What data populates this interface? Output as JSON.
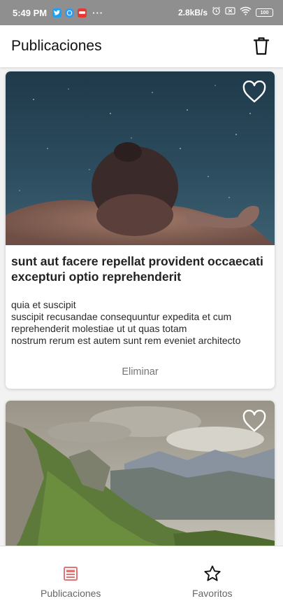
{
  "status_bar": {
    "time": "5:49 PM",
    "app_icons": [
      "twitter-icon",
      "whatsapp-icon",
      "app-notification-icon"
    ],
    "more": "···",
    "network_speed": "2.8kB/s",
    "battery": "100"
  },
  "app_bar": {
    "title": "Publicaciones",
    "action_icon": "trash-icon"
  },
  "posts": [
    {
      "image": "underwater-swimmer-photo",
      "title": "sunt aut facere repellat provident occaecati excepturi optio reprehenderit",
      "body": "quia et suscipit\nsuscipit recusandae consequuntur expedita et cum reprehenderit molestiae ut ut quas totam\nnostrum rerum est autem sunt rem eveniet architecto",
      "action_label": "Eliminar",
      "favorite_icon": "heart-outline-icon"
    },
    {
      "image": "mountain-valley-photo",
      "favorite_icon": "heart-outline-icon"
    }
  ],
  "bottom_nav": {
    "items": [
      {
        "label": "Publicaciones",
        "icon": "list-icon",
        "active": true,
        "color": "#e57373"
      },
      {
        "label": "Favoritos",
        "icon": "star-outline-icon",
        "active": false,
        "color": "#111111"
      }
    ]
  }
}
